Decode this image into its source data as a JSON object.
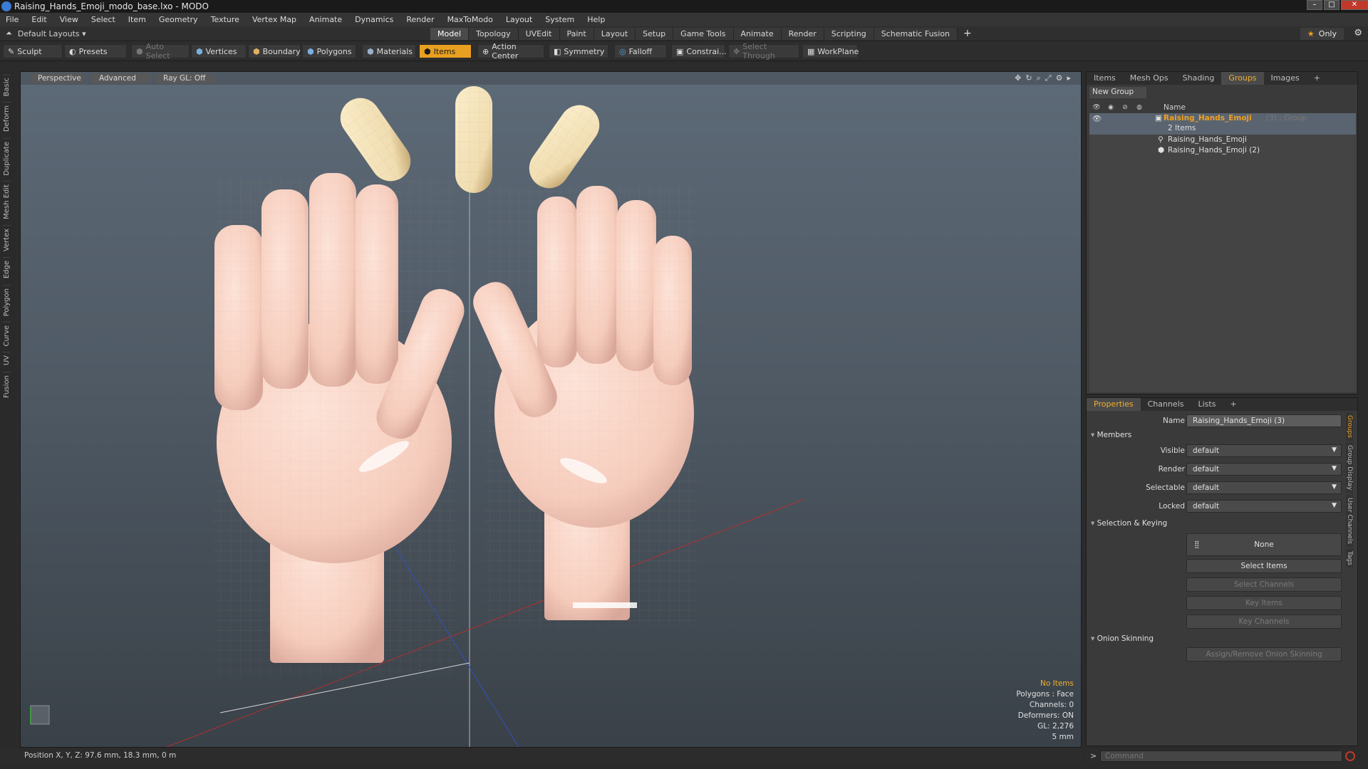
{
  "window": {
    "title": "Raising_Hands_Emoji_modo_base.lxo - MODO"
  },
  "menu": [
    "File",
    "Edit",
    "View",
    "Select",
    "Item",
    "Geometry",
    "Texture",
    "Vertex Map",
    "Animate",
    "Dynamics",
    "Render",
    "MaxToModo",
    "Layout",
    "System",
    "Help"
  ],
  "layoutbar": {
    "layout_name": "Default Layouts ▾",
    "tabs": [
      "Model",
      "Topology",
      "UVEdit",
      "Paint",
      "Layout",
      "Setup",
      "Game Tools",
      "Animate",
      "Render",
      "Scripting",
      "Schematic Fusion"
    ],
    "active_tab": "Model",
    "only_label": "Only"
  },
  "toolbar": {
    "sculpt": "Sculpt",
    "presets": "Presets",
    "auto_select": "Auto Select",
    "vertices": "Vertices",
    "boundary": "Boundary",
    "polygons": "Polygons",
    "materials": "Materials",
    "items": "Items",
    "action_center": "Action Center",
    "symmetry": "Symmetry",
    "falloff": "Falloff",
    "constraints": "Constrai...",
    "select_through": "Select Through",
    "workplane": "WorkPlane"
  },
  "left_tabs": [
    "Basic",
    "Deform",
    "Duplicate",
    "Mesh Edit",
    "Vertex",
    "Edge",
    "Polygon",
    "Curve",
    "UV",
    "Fusion"
  ],
  "viewport": {
    "perspective": "Perspective",
    "advanced": "Advanced",
    "raygl": "Ray GL: Off",
    "info": {
      "no_items": "No Items",
      "polygons": "Polygons : Face",
      "channels": "Channels: 0",
      "deformers": "Deformers: ON",
      "gl": "GL: 2,276",
      "scale": "5 mm"
    },
    "colors": {
      "skin": "#f6cdbd",
      "nail": "#f0ddb0"
    }
  },
  "status": {
    "position": "Position X, Y, Z:  97.6 mm, 18.3 mm, 0 m"
  },
  "groups_panel": {
    "tabs": [
      "Items",
      "Mesh Ops",
      "Shading",
      "Groups",
      "Images"
    ],
    "active_tab": "Groups",
    "new_group": "New Group",
    "column_name": "Name",
    "group": {
      "name": "Raising_Hands_Emoji",
      "suffix": "(3) : Group",
      "count": "2 Items"
    },
    "children": [
      "Raising_Hands_Emoji",
      "Raising_Hands_Emoji (2)"
    ]
  },
  "properties_panel": {
    "tabs": [
      "Properties",
      "Channels",
      "Lists"
    ],
    "active_tab": "Properties",
    "name_label": "Name",
    "name_value": "Raising_Hands_Emoji (3)",
    "members_section": "Members",
    "members": [
      {
        "label": "Visible",
        "value": "default"
      },
      {
        "label": "Render",
        "value": "default"
      },
      {
        "label": "Selectable",
        "value": "default"
      },
      {
        "label": "Locked",
        "value": "default"
      }
    ],
    "selection_section": "Selection & Keying",
    "none_label": "None",
    "select_items": "Select Items",
    "select_channels": "Select Channels",
    "key_items": "Key Items",
    "key_channels": "Key Channels",
    "onion_section": "Onion Skinning",
    "onion_button": "Assign/Remove Onion Skinning",
    "side_tabs": [
      "Groups",
      "Group Display",
      "User Channels",
      "Tags"
    ]
  },
  "command": {
    "placeholder": "Command"
  }
}
